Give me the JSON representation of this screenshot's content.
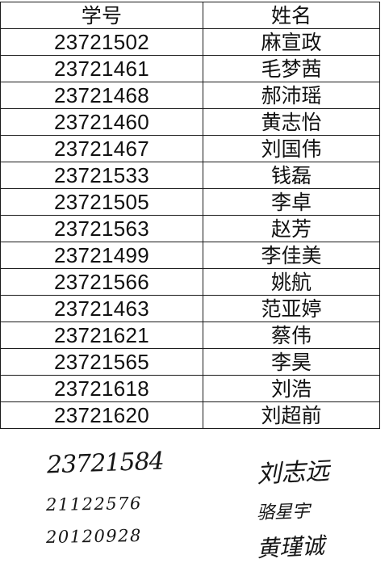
{
  "table": {
    "header": {
      "student_id": "学号",
      "name": "姓名"
    },
    "rows": [
      {
        "student_id": "23721502",
        "name": "麻宣政"
      },
      {
        "student_id": "23721461",
        "name": "毛梦茜"
      },
      {
        "student_id": "23721468",
        "name": "郝沛瑶"
      },
      {
        "student_id": "23721460",
        "name": "黄志怡"
      },
      {
        "student_id": "23721467",
        "name": "刘国伟"
      },
      {
        "student_id": "23721533",
        "name": "钱磊"
      },
      {
        "student_id": "23721505",
        "name": "李卓"
      },
      {
        "student_id": "23721563",
        "name": "赵芳"
      },
      {
        "student_id": "23721499",
        "name": "李佳美"
      },
      {
        "student_id": "23721566",
        "name": "姚航"
      },
      {
        "student_id": "23721463",
        "name": "范亚婷"
      },
      {
        "student_id": "23721621",
        "name": "蔡伟"
      },
      {
        "student_id": "23721565",
        "name": "李昊"
      },
      {
        "student_id": "23721618",
        "name": "刘浩"
      },
      {
        "student_id": "23721620",
        "name": "刘超前"
      }
    ]
  },
  "handwritten": [
    {
      "student_id": "23721584",
      "name": "刘志远"
    },
    {
      "student_id": "21122576",
      "name": "骆星宇"
    },
    {
      "student_id": "20120928",
      "name": "黄瑾诚"
    }
  ]
}
